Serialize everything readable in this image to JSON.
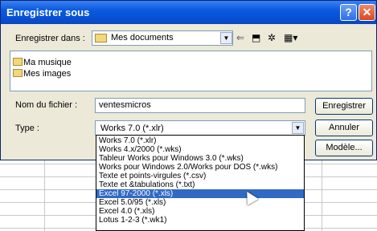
{
  "window": {
    "title": "Enregistrer sous"
  },
  "titlebar": {
    "help_label": "?",
    "close_label": "✕"
  },
  "save_in": {
    "label": "Enregistrer dans :",
    "value": "Mes documents"
  },
  "toolbar": {
    "icons": [
      "back-arrow-icon",
      "up-folder-icon",
      "new-folder-icon",
      "views-menu-icon"
    ]
  },
  "files": [
    {
      "name": "Ma musique"
    },
    {
      "name": "Mes images"
    }
  ],
  "filename": {
    "label": "Nom du fichier :",
    "value": "ventesmicros"
  },
  "type": {
    "label": "Type :",
    "value": "Works 7.0 (*.xlr)",
    "options": [
      "Works 7.0 (*.xlr)",
      "Works 4.x/2000 (*.wks)",
      "Tableur Works pour Windows 3.0 (*.wks)",
      "Works pour Windows 2.0/Works pour DOS (*.wks)",
      "Texte et points-virgules (*.csv)",
      "Texte et &tabulations (*.txt)",
      "Excel 97-2000 (*.xls)",
      "Excel 5.0/95 (*.xls)",
      "Excel 4.0 (*.xls)",
      "Lotus 1-2-3 (*.wk1)"
    ],
    "selected_option": "Excel 97-2000 (*.xls)"
  },
  "buttons": {
    "save": "Enregistrer",
    "cancel": "Annuler",
    "template": "Modèle..."
  },
  "colors": {
    "title_bar": "#0a5ae0",
    "selection": "#316ac5",
    "dialog_bg": "#ece9d8"
  }
}
